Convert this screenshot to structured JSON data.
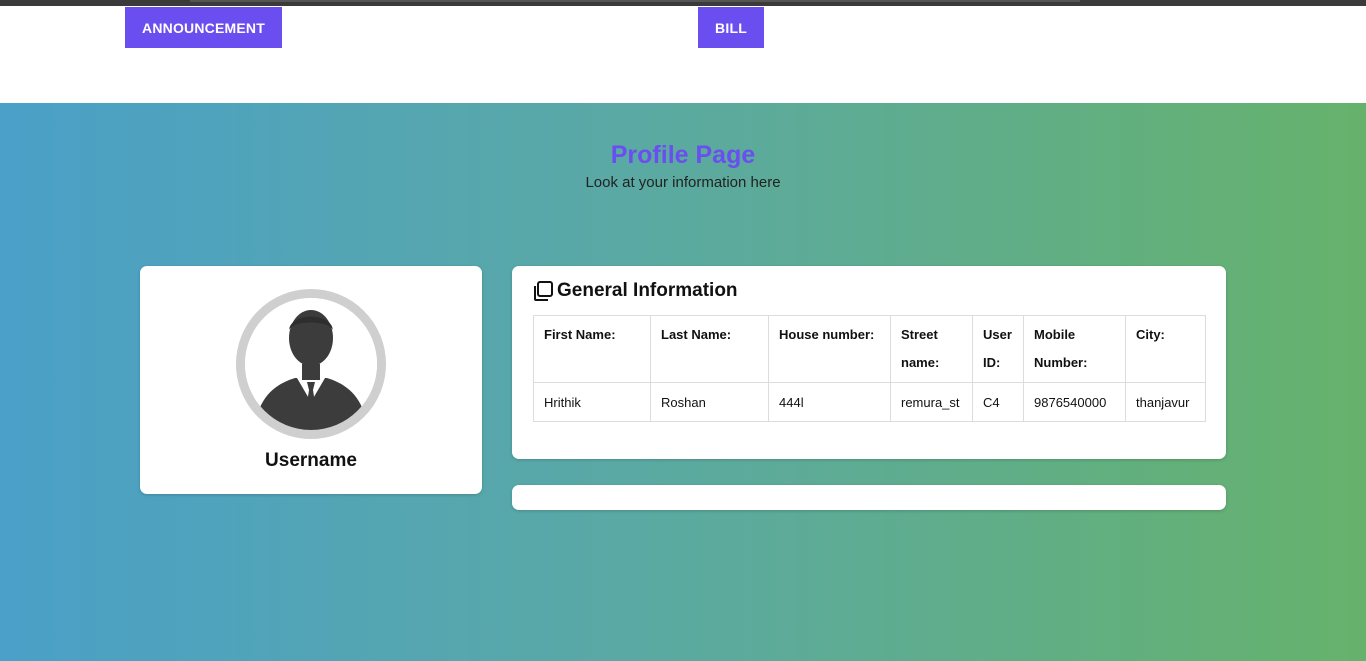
{
  "nav": {
    "announcement_label": "ANNOUNCEMENT",
    "bill_label": "BILL"
  },
  "page": {
    "title": "Profile Page",
    "subtitle": "Look at your information here"
  },
  "profile": {
    "username": "Username",
    "avatar_icon": "user-silhouette-icon"
  },
  "general_info": {
    "heading": "General Information",
    "heading_icon": "copy-icon",
    "columns": [
      "First Name:",
      "Last Name:",
      "House number:",
      "Street name:",
      "User ID:",
      "Mobile Number:",
      "City:"
    ],
    "row": [
      "Hrithik",
      "Roshan",
      "444l",
      "remura_st",
      "C4",
      "9876540000",
      "thanjavur"
    ]
  },
  "colors": {
    "accent": "#6b4ef0",
    "gradient_start": "#4aa0c8",
    "gradient_end": "#66b26c"
  }
}
